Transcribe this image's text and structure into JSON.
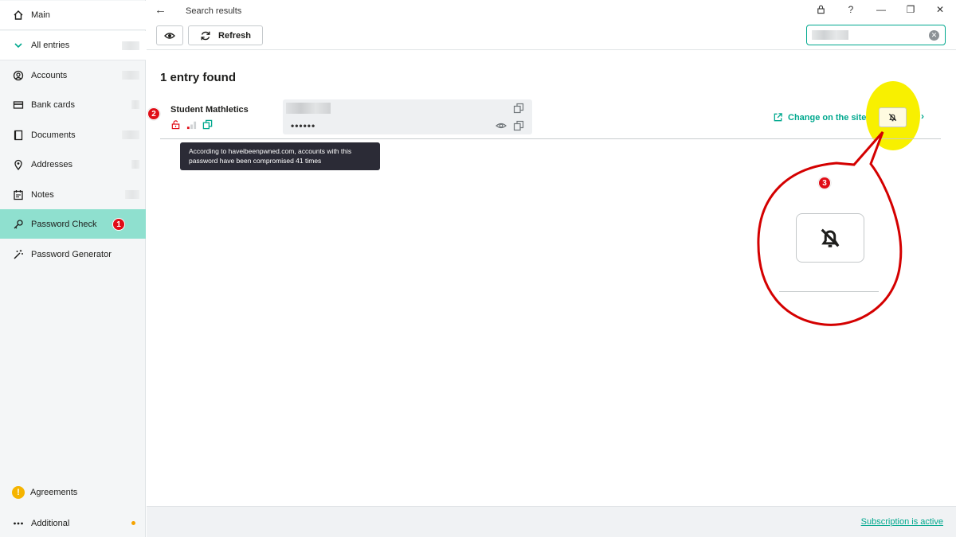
{
  "sidebar": {
    "main": "Main",
    "all_entries": "All entries",
    "items": [
      {
        "label": "Accounts",
        "icon": "account-icon"
      },
      {
        "label": "Bank cards",
        "icon": "card-icon"
      },
      {
        "label": "Documents",
        "icon": "document-icon"
      },
      {
        "label": "Addresses",
        "icon": "location-icon"
      },
      {
        "label": "Notes",
        "icon": "notes-icon"
      },
      {
        "label": "Password Check",
        "icon": "key-icon"
      },
      {
        "label": "Password Generator",
        "icon": "magic-wand-icon"
      }
    ],
    "agreements": "Agreements",
    "additional": "Additional"
  },
  "header": {
    "breadcrumb": "Search results",
    "refresh_label": "Refresh"
  },
  "window_controls": {
    "lock": "🔒",
    "help": "?",
    "minimize": "—",
    "restore": "❐",
    "close": "✕"
  },
  "results": {
    "count_text": "1 entry found",
    "entry": {
      "name": "Student Mathletics",
      "password_mask": "••••••",
      "tooltip": "According to haveibeenpwned.com, accounts with this password have been compromised 41 times",
      "change_link": "Change on the site"
    }
  },
  "annotations": {
    "one": "1",
    "two": "2",
    "three": "3"
  },
  "footer": {
    "subscription": "Subscription is active"
  },
  "colors": {
    "accent": "#00a88e",
    "active_nav": "#8fe0cf",
    "annotation_red": "#e00d17",
    "highlight_yellow": "#f8f000"
  }
}
